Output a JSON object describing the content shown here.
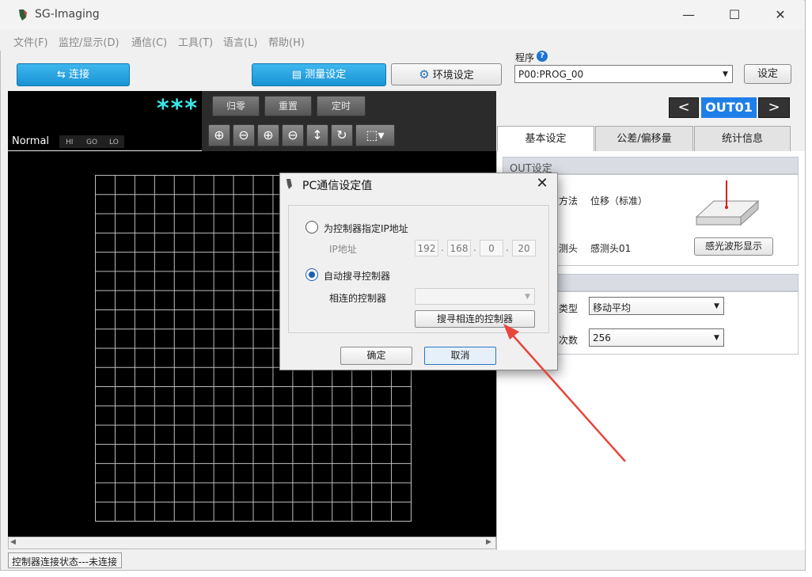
{
  "window": {
    "title": "SG-Imaging",
    "minimize": "—",
    "maximize": "☐",
    "close": "✕"
  },
  "menu": [
    "文件(F)",
    "监控/显示(D)",
    "通信(C)",
    "工具(T)",
    "语言(L)",
    "帮助(H)"
  ],
  "toolbar": {
    "connect_label": "连接",
    "measure_label": "测量设定",
    "env_label": "环境设定",
    "program_label": "程序",
    "program_value": "P00:PROG_00",
    "set_label": "设定"
  },
  "display": {
    "value": "***",
    "mode": "Normal",
    "indicators": [
      "HI",
      "GO",
      "LO"
    ],
    "zero_label": "归零",
    "reset_label": "重置",
    "timing_label": "定时"
  },
  "output": {
    "label": "OUT01",
    "prev": "<",
    "next": ">"
  },
  "tabs": [
    "基本设定",
    "公差/偏移量",
    "统计信息"
  ],
  "out_settings": {
    "header": "OUT设定",
    "method_label": "方法",
    "method_value": "位移（标准）",
    "sensor_label": "测头",
    "sensor_value": "感测头01",
    "waveform_button": "感光波形显示"
  },
  "filter": {
    "type_label": "类型",
    "type_value": "移动平均",
    "count_label": "次数",
    "count_value": "256"
  },
  "status": "控制器连接状态---未连接",
  "dialog": {
    "title": "PC通信设定值",
    "option_manual": "为控制器指定IP地址",
    "ip_label": "IP地址",
    "ip": [
      "192",
      "168",
      "0",
      "20"
    ],
    "option_auto": "自动搜寻控制器",
    "connected_label": "相连的控制器",
    "search_button": "搜寻相连的控制器",
    "ok_button": "确定",
    "cancel_button": "取消",
    "close": "✕"
  },
  "colors": {
    "accent": "#1993d4",
    "output_badge": "#1f7fe8",
    "display_value": "#38e8ea",
    "annotation_arrow": "#e8453c"
  }
}
